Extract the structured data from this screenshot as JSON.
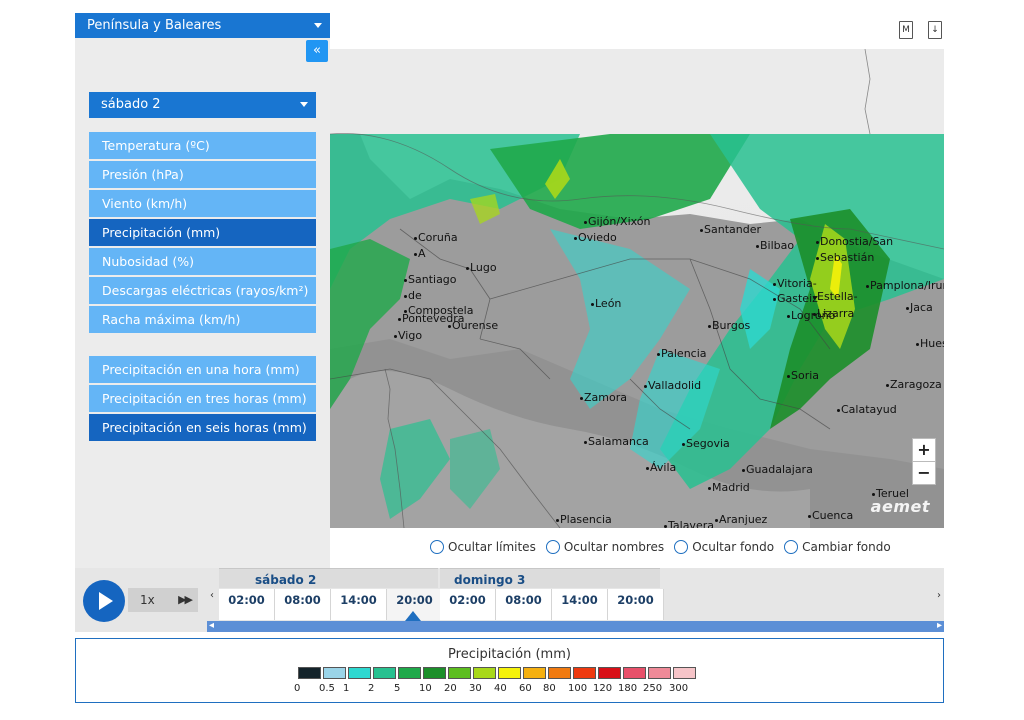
{
  "region": {
    "selected": "Península y Baleares"
  },
  "panel": {
    "collapse_icon": "«"
  },
  "day": {
    "selected": "sábado 2"
  },
  "variables": [
    {
      "label": "Temperatura (ºC)",
      "active": false
    },
    {
      "label": "Presión (hPa)",
      "active": false
    },
    {
      "label": "Viento (km/h)",
      "active": false
    },
    {
      "label": "Precipitación (mm)",
      "active": true
    },
    {
      "label": "Nubosidad (%)",
      "active": false
    },
    {
      "label": "Descargas eléctricas (rayos/km²)",
      "active": false
    },
    {
      "label": "Racha máxima (km/h)",
      "active": false
    }
  ],
  "accumulations": [
    {
      "label": "Precipitación en una hora (mm)",
      "active": false
    },
    {
      "label": "Precipitación en tres horas (mm)",
      "active": false
    },
    {
      "label": "Precipitación en seis horas (mm)",
      "active": true
    }
  ],
  "toolbar": {
    "map_icon_text": "M",
    "download_icon_text": "↓"
  },
  "map": {
    "cities": [
      "Coruña",
      "A",
      "Santiago",
      "de",
      "Compostela",
      "Pontevedra",
      "Vigo",
      "Lugo",
      "Ourense",
      "Gijón/Xixón",
      "Oviedo",
      "Santander",
      "Bilbao",
      "Donostia/San",
      "Sebastián",
      "Vitoria-",
      "Gasteiz",
      "Estella-",
      "Lizarra",
      "Logroño",
      "Pamplona/Iruña",
      "Jaca",
      "Hues",
      "León",
      "Burgos",
      "Palencia",
      "Valladolid",
      "Soria",
      "Zaragoza",
      "Calatayud",
      "Zamora",
      "Salamanca",
      "Segovia",
      "Ávila",
      "Guadalajara",
      "Madrid",
      "Teruel",
      "Plasencia",
      "Talavera",
      "Aranjuez",
      "Cuenca"
    ],
    "zoom_in": "+",
    "zoom_out": "−",
    "watermark": "aemet"
  },
  "map_options": [
    {
      "label": "Ocultar límites"
    },
    {
      "label": "Ocultar nombres"
    },
    {
      "label": "Ocultar fondo"
    },
    {
      "label": "Cambiar fondo"
    }
  ],
  "player": {
    "speed": "1x",
    "fast_forward_icon": "▶▶"
  },
  "timeline": {
    "prev_icon": "‹",
    "next_icon": "›",
    "days": [
      {
        "label": "sábado 2",
        "slots": [
          "02:00",
          "08:00",
          "14:00",
          "20:00"
        ]
      },
      {
        "label": "domingo 3",
        "slots": [
          "02:00",
          "08:00",
          "14:00",
          "20:00"
        ]
      }
    ],
    "selected_slot": "sábado 2 20:00",
    "progress_left_icon": "◂",
    "progress_right_icon": "▸"
  },
  "legend": {
    "title": "Precipitación (mm)",
    "labels": [
      "0",
      "0.5",
      "1",
      "2",
      "5",
      "10",
      "20",
      "30",
      "40",
      "60",
      "80",
      "100",
      "120",
      "180",
      "250",
      "300"
    ],
    "colors": [
      "#14232a",
      "#9ad4e8",
      "#2ed8d0",
      "#28c190",
      "#1fa94a",
      "#1c8f2a",
      "#5dbe1f",
      "#a8d81a",
      "#f5f20a",
      "#f5b010",
      "#f07a10",
      "#ee3a10",
      "#d81018",
      "#e8506a",
      "#ef8a98",
      "#f6c4c8"
    ]
  }
}
